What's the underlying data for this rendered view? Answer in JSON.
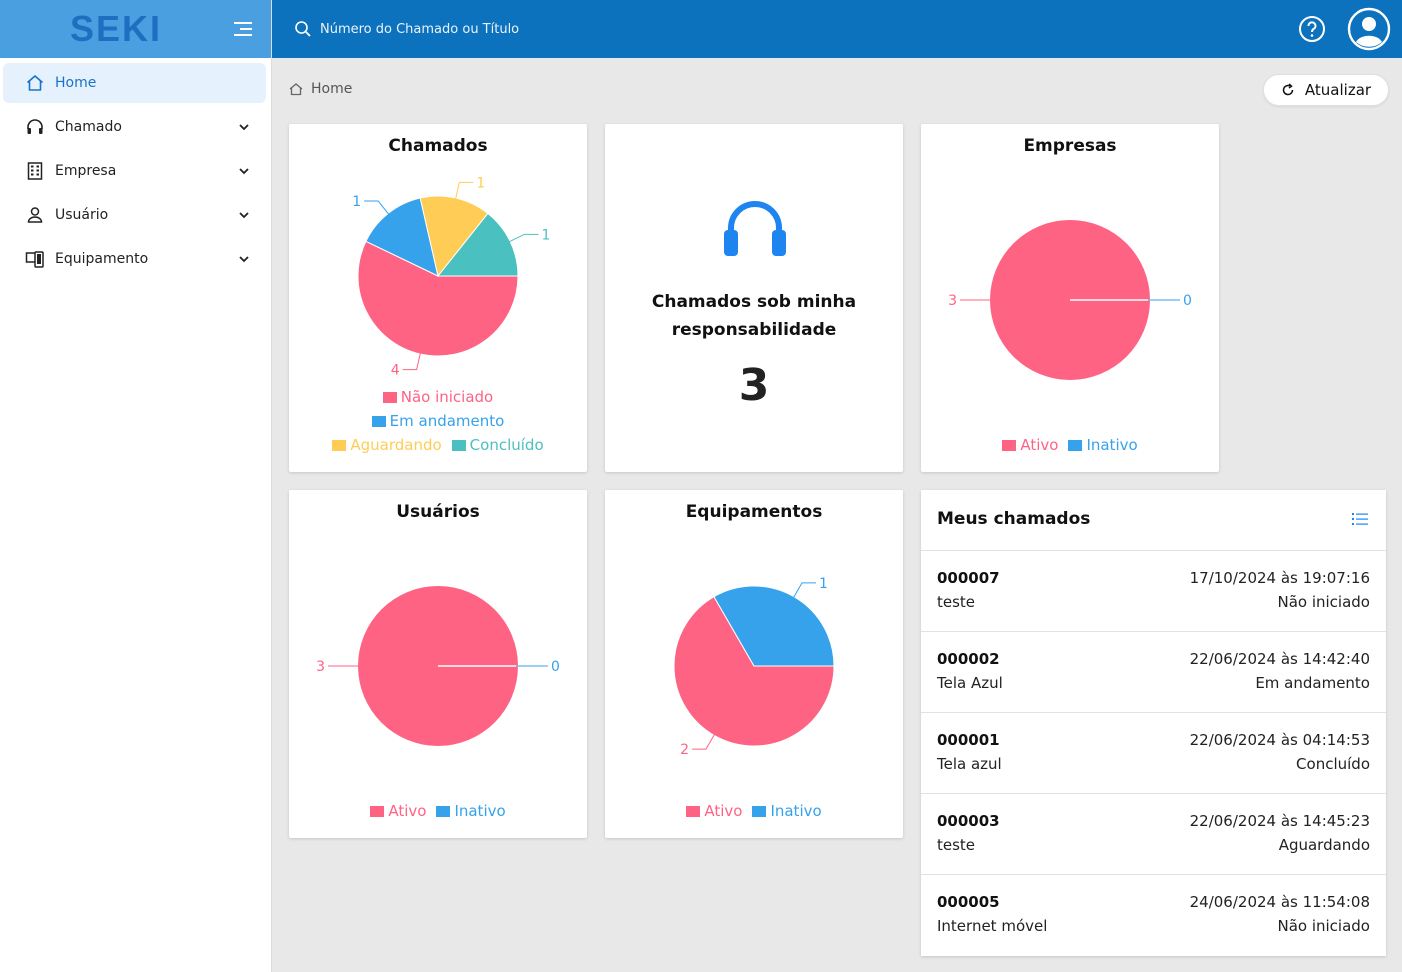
{
  "app": {
    "logo": "SEKI"
  },
  "search": {
    "placeholder": "Número do Chamado ou Título"
  },
  "sidebar": {
    "items": [
      {
        "label": "Home",
        "icon": "home-icon"
      },
      {
        "label": "Chamado",
        "icon": "headset-icon"
      },
      {
        "label": "Empresa",
        "icon": "building-icon"
      },
      {
        "label": "Usuário",
        "icon": "user-icon"
      },
      {
        "label": "Equipamento",
        "icon": "devices-icon"
      }
    ]
  },
  "breadcrumb": {
    "label": "Home"
  },
  "refresh": {
    "label": "Atualizar"
  },
  "colors": {
    "pink": "#ff6384",
    "blue": "#36a2eb",
    "yellow": "#ffcd56",
    "teal": "#4bc0c0",
    "primary": "#0d72bd"
  },
  "chamados_card": {
    "title": "Chamados"
  },
  "responsabilidade_card": {
    "title": "Chamados sob minha responsabilidade",
    "count": "3"
  },
  "empresas_card": {
    "title": "Empresas"
  },
  "usuarios_card": {
    "title": "Usuários"
  },
  "equipamentos_card": {
    "title": "Equipamentos"
  },
  "chart_data": [
    {
      "type": "pie",
      "title": "Chamados",
      "categories": [
        "Não iniciado",
        "Em andamento",
        "Aguardando",
        "Concluído"
      ],
      "values": [
        4,
        1,
        1,
        1
      ],
      "colors": [
        "#ff6384",
        "#36a2eb",
        "#ffcd56",
        "#4bc0c0"
      ],
      "legend": "bottom"
    },
    {
      "type": "pie",
      "title": "Empresas",
      "categories": [
        "Ativo",
        "Inativo"
      ],
      "values": [
        3,
        0
      ],
      "colors": [
        "#ff6384",
        "#36a2eb"
      ],
      "legend": "bottom"
    },
    {
      "type": "pie",
      "title": "Usuários",
      "categories": [
        "Ativo",
        "Inativo"
      ],
      "values": [
        3,
        0
      ],
      "colors": [
        "#ff6384",
        "#36a2eb"
      ],
      "legend": "bottom"
    },
    {
      "type": "pie",
      "title": "Equipamentos",
      "categories": [
        "Ativo",
        "Inativo"
      ],
      "values": [
        2,
        1
      ],
      "colors": [
        "#ff6384",
        "#36a2eb"
      ],
      "legend": "bottom"
    }
  ],
  "meus_chamados": {
    "title": "Meus chamados",
    "tickets": [
      {
        "id": "000007",
        "title": "teste",
        "date": "17/10/2024 às 19:07:16",
        "status": "Não iniciado"
      },
      {
        "id": "000002",
        "title": "Tela Azul",
        "date": "22/06/2024 às 14:42:40",
        "status": "Em andamento"
      },
      {
        "id": "000001",
        "title": "Tela azul",
        "date": "22/06/2024 às 04:14:53",
        "status": "Concluído"
      },
      {
        "id": "000003",
        "title": "teste",
        "date": "22/06/2024 às 14:45:23",
        "status": "Aguardando"
      },
      {
        "id": "000005",
        "title": "Internet móvel",
        "date": "24/06/2024 às 11:54:08",
        "status": "Não iniciado"
      }
    ]
  }
}
